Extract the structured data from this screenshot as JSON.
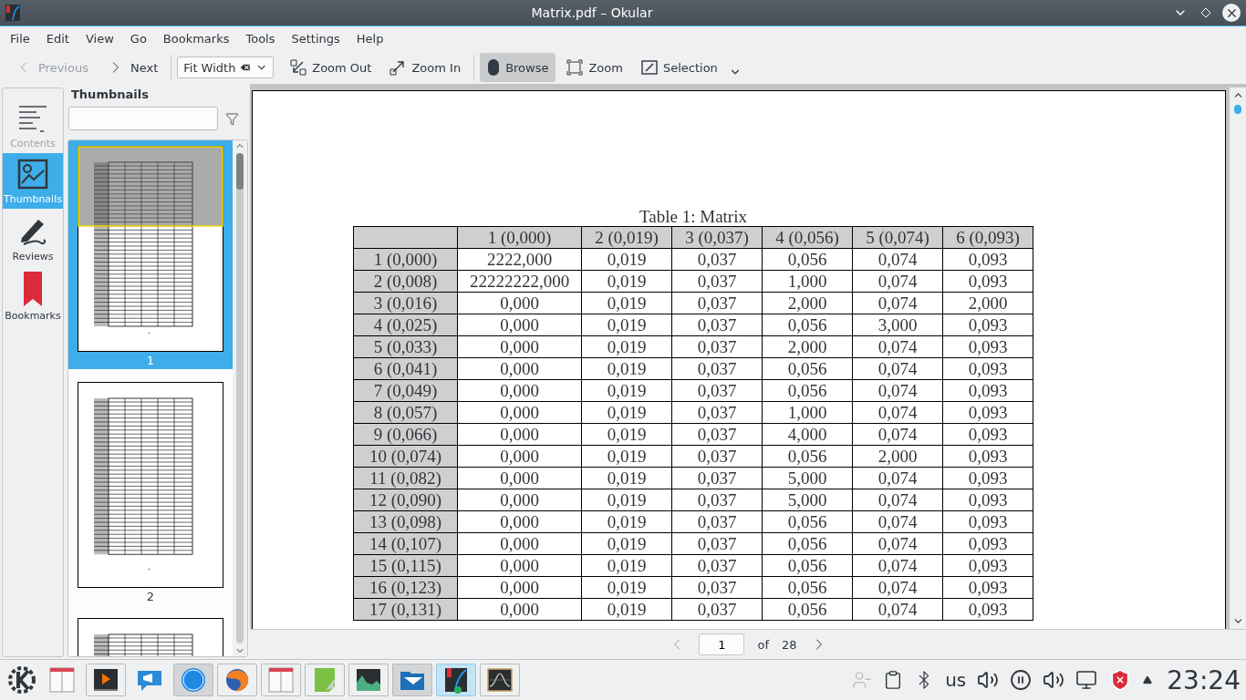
{
  "window": {
    "title": "Matrix.pdf – Okular"
  },
  "menu": [
    "File",
    "Edit",
    "View",
    "Go",
    "Bookmarks",
    "Tools",
    "Settings",
    "Help"
  ],
  "toolbar": {
    "nav": [
      {
        "label": "Previous",
        "disabled": true
      },
      {
        "label": "Next",
        "disabled": false
      }
    ],
    "zoom_combo": {
      "value": "Fit Width"
    },
    "zoom": [
      "Zoom Out",
      "Zoom In"
    ],
    "modes": [
      {
        "label": "Browse",
        "selected": true
      },
      {
        "label": "Zoom",
        "selected": false
      },
      {
        "label": "Selection",
        "selected": false
      }
    ]
  },
  "sidebar": {
    "tabs": [
      {
        "label": "Contents",
        "selected": false,
        "disabled": true
      },
      {
        "label": "Thumbnails",
        "selected": true,
        "disabled": false
      },
      {
        "label": "Reviews",
        "selected": false,
        "disabled": false
      },
      {
        "label": "Bookmarks",
        "selected": false,
        "disabled": false
      }
    ]
  },
  "thumbnails": {
    "title": "Thumbnails",
    "pages": [
      {
        "label": "1",
        "selected": true
      },
      {
        "label": "2",
        "selected": false
      },
      {
        "selected": false
      }
    ]
  },
  "document": {
    "caption": "Table 1: Matrix",
    "columns": [
      "1 (0,000)",
      "2 (0,019)",
      "3 (0,037)",
      "4 (0,056)",
      "5 (0,074)",
      "6 (0,093)"
    ],
    "rows": [
      {
        "label": "1 (0,000)",
        "cells": [
          "2222,000",
          "0,019",
          "0,037",
          "0,056",
          "0,074",
          "0,093"
        ]
      },
      {
        "label": "2 (0,008)",
        "cells": [
          "22222222,000",
          "0,019",
          "0,037",
          "1,000",
          "0,074",
          "0,093"
        ]
      },
      {
        "label": "3 (0,016)",
        "cells": [
          "0,000",
          "0,019",
          "0,037",
          "2,000",
          "0,074",
          "2,000"
        ]
      },
      {
        "label": "4 (0,025)",
        "cells": [
          "0,000",
          "0,019",
          "0,037",
          "0,056",
          "3,000",
          "0,093"
        ]
      },
      {
        "label": "5 (0,033)",
        "cells": [
          "0,000",
          "0,019",
          "0,037",
          "2,000",
          "0,074",
          "0,093"
        ]
      },
      {
        "label": "6 (0,041)",
        "cells": [
          "0,000",
          "0,019",
          "0,037",
          "0,056",
          "0,074",
          "0,093"
        ]
      },
      {
        "label": "7 (0,049)",
        "cells": [
          "0,000",
          "0,019",
          "0,037",
          "0,056",
          "0,074",
          "0,093"
        ]
      },
      {
        "label": "8 (0,057)",
        "cells": [
          "0,000",
          "0,019",
          "0,037",
          "1,000",
          "0,074",
          "0,093"
        ]
      },
      {
        "label": "9 (0,066)",
        "cells": [
          "0,000",
          "0,019",
          "0,037",
          "4,000",
          "0,074",
          "0,093"
        ]
      },
      {
        "label": "10 (0,074)",
        "cells": [
          "0,000",
          "0,019",
          "0,037",
          "0,056",
          "2,000",
          "0,093"
        ]
      },
      {
        "label": "11 (0,082)",
        "cells": [
          "0,000",
          "0,019",
          "0,037",
          "5,000",
          "0,074",
          "0,093"
        ]
      },
      {
        "label": "12 (0,090)",
        "cells": [
          "0,000",
          "0,019",
          "0,037",
          "5,000",
          "0,074",
          "0,093"
        ]
      },
      {
        "label": "13 (0,098)",
        "cells": [
          "0,000",
          "0,019",
          "0,037",
          "0,056",
          "0,074",
          "0,093"
        ]
      },
      {
        "label": "14 (0,107)",
        "cells": [
          "0,000",
          "0,019",
          "0,037",
          "0,056",
          "0,074",
          "0,093"
        ]
      },
      {
        "label": "15 (0,115)",
        "cells": [
          "0,000",
          "0,019",
          "0,037",
          "0,056",
          "0,074",
          "0,093"
        ]
      },
      {
        "label": "16 (0,123)",
        "cells": [
          "0,000",
          "0,019",
          "0,037",
          "0,056",
          "0,074",
          "0,093"
        ]
      },
      {
        "label": "17 (0,131)",
        "cells": [
          "0,000",
          "0,019",
          "0,037",
          "0,056",
          "0,074",
          "0,093"
        ]
      }
    ]
  },
  "page_nav": {
    "current": "1",
    "of": "of",
    "total": "28"
  },
  "taskbar": {
    "tasks": [
      {
        "open": false,
        "highlighted": false,
        "selected": false
      },
      {
        "open": true,
        "highlighted": false,
        "selected": false
      },
      {
        "open": false,
        "highlighted": false,
        "selected": false
      },
      {
        "open": true,
        "highlighted": true,
        "selected": false
      },
      {
        "open": true,
        "highlighted": false,
        "selected": false
      },
      {
        "open": true,
        "highlighted": false,
        "selected": false
      },
      {
        "open": true,
        "highlighted": false,
        "selected": false
      },
      {
        "open": true,
        "highlighted": false,
        "selected": false
      },
      {
        "open": true,
        "highlighted": true,
        "selected": false
      },
      {
        "open": true,
        "highlighted": false,
        "selected": true
      },
      {
        "open": true,
        "highlighted": false,
        "selected": false
      }
    ],
    "layout": "us",
    "clock": "23:24"
  }
}
